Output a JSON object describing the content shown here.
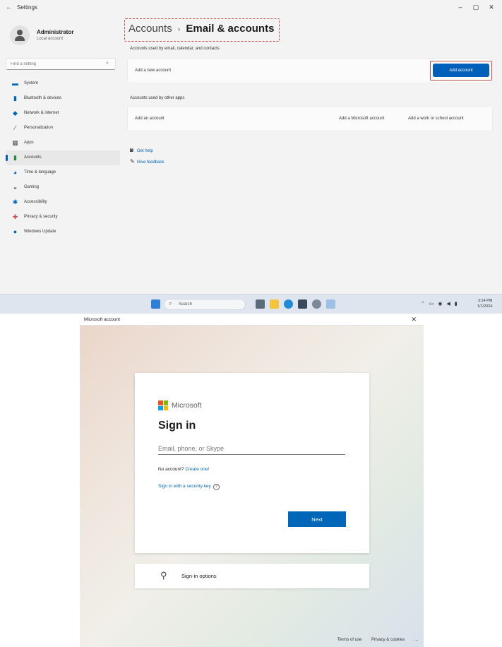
{
  "settings_window": {
    "app_title": "Settings",
    "profile": {
      "name": "Administrator",
      "subtitle": "Local account"
    },
    "search_placeholder": "Find a setting",
    "nav": [
      {
        "label": "System",
        "icon": "monitor-icon",
        "color": "#0067c0"
      },
      {
        "label": "Bluetooth & devices",
        "icon": "bluetooth-icon",
        "color": "#0067c0"
      },
      {
        "label": "Network & internet",
        "icon": "wifi-icon",
        "color": "#0067c0"
      },
      {
        "label": "Personalization",
        "icon": "brush-icon",
        "color": "#555555"
      },
      {
        "label": "Apps",
        "icon": "apps-icon",
        "color": "#555555"
      },
      {
        "label": "Accounts",
        "icon": "person-icon",
        "color": "#2a8a3e",
        "active": true
      },
      {
        "label": "Time & language",
        "icon": "globe-clock-icon",
        "color": "#0067c0"
      },
      {
        "label": "Gaming",
        "icon": "gamepad-icon",
        "color": "#555555"
      },
      {
        "label": "Accessibility",
        "icon": "accessibility-icon",
        "color": "#0067c0"
      },
      {
        "label": "Privacy & security",
        "icon": "shield-icon",
        "color": "#c0504d"
      },
      {
        "label": "Windows Update",
        "icon": "update-icon",
        "color": "#0067c0"
      }
    ],
    "breadcrumb": {
      "parent": "Accounts",
      "separator": "›",
      "current": "Email & accounts"
    },
    "section1_label": "Accounts used by email, calendar, and contacts",
    "add_account_label": "Add a new account",
    "add_account_button": "Add account",
    "section2_label": "Accounts used by other apps",
    "add_account_row_label": "Add an account",
    "add_ms_account_link": "Add a Microsoft account",
    "add_work_account_link": "Add a work or school account",
    "help_links": [
      "Get help",
      "Give feedback"
    ],
    "taskbar": {
      "search_placeholder": "Search",
      "clock_time": "3:14 PM",
      "clock_date": "1/1/2024"
    }
  },
  "dialog": {
    "title": "Microsoft account",
    "brand": "Microsoft",
    "brand_colors": [
      "#f25022",
      "#7fba00",
      "#00a4ef",
      "#ffb900"
    ],
    "heading": "Sign in",
    "email_placeholder": "Email, phone, or Skype",
    "no_account_text": "No account?",
    "create_one_link": "Create one!",
    "security_key_link": "Sign in with a security key",
    "next_button": "Next",
    "sign_in_options": "Sign-in options",
    "footer_terms": "Terms of use",
    "footer_privacy": "Privacy & cookies",
    "footer_more": "..."
  }
}
